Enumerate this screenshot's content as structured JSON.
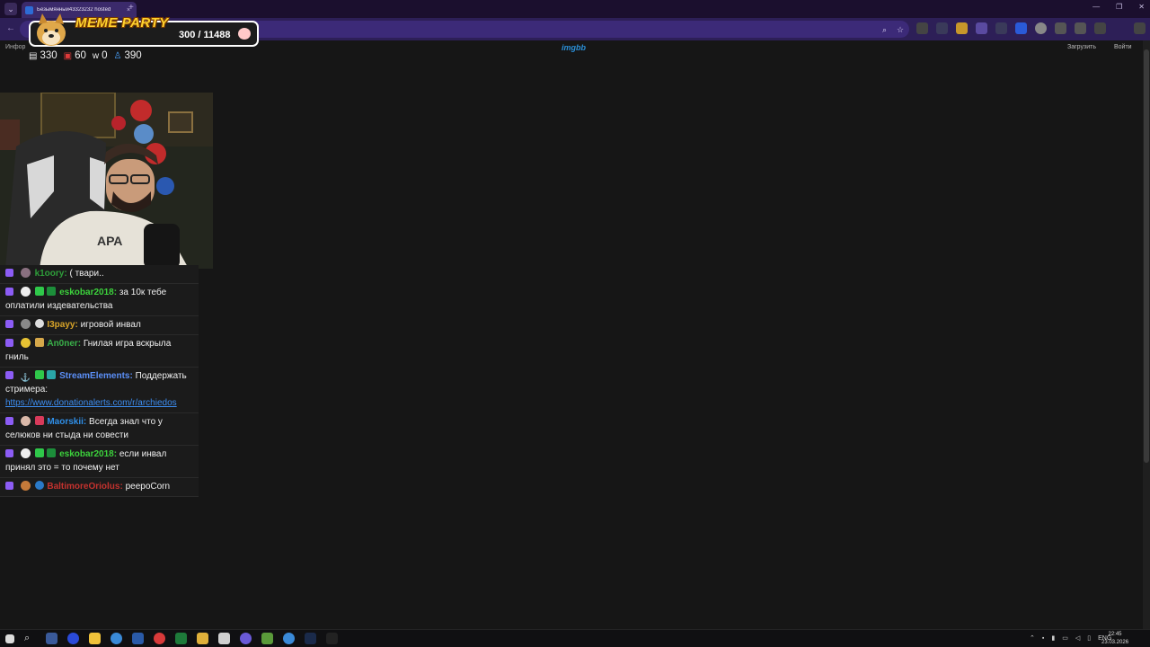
{
  "browser": {
    "tab_title": "Безымянный43323232 hosted",
    "tab_close": "×",
    "new_tab": "+",
    "back": "←",
    "win_controls": [
      "—",
      "❐",
      "✕"
    ]
  },
  "page": {
    "info_label": "Инфор",
    "logo": "imgbb",
    "upload_label": "Загрузить",
    "login_label": "Войти"
  },
  "meme_party": {
    "title": "MEME PARTY",
    "progress": "300 / 11488"
  },
  "stats": {
    "chat_count": "330",
    "live_count": "60",
    "w_count": "0",
    "viewers": "390"
  },
  "chat": [
    {
      "user": "k1oory:",
      "text": "( твари..",
      "color": "#2e9e3a",
      "link": ""
    },
    {
      "user": "eskobar2018:",
      "text": "за 10к тебе оплатили издевательства",
      "color": "#3cd23c",
      "link": ""
    },
    {
      "user": "I3payy:",
      "text": "игровой инвал",
      "color": "#d8a428",
      "link": ""
    },
    {
      "user": "An0ner:",
      "text": "Гнилая игра вскрыла гниль",
      "color": "#3ab04a",
      "link": ""
    },
    {
      "user": "StreamElements:",
      "text": "Поддержать стримера:",
      "color": "#5b8ff7",
      "link": "https://www.donationalerts.com/r/archiedos"
    },
    {
      "user": "Maorskii:",
      "text": "Всегда знал что у селюков ни стыда ни совести",
      "color": "#2f8fe8",
      "link": ""
    },
    {
      "user": "eskobar2018:",
      "text": "если инвал принял это = то почему нет",
      "color": "#3cd23c",
      "link": ""
    },
    {
      "user": "BaltimoreOriolus:",
      "text": "peepoCorn",
      "color": "#c4322e",
      "link": ""
    }
  ],
  "taskbar": {
    "language": "ENG",
    "time": "22:45",
    "date": "23.03.2026"
  }
}
